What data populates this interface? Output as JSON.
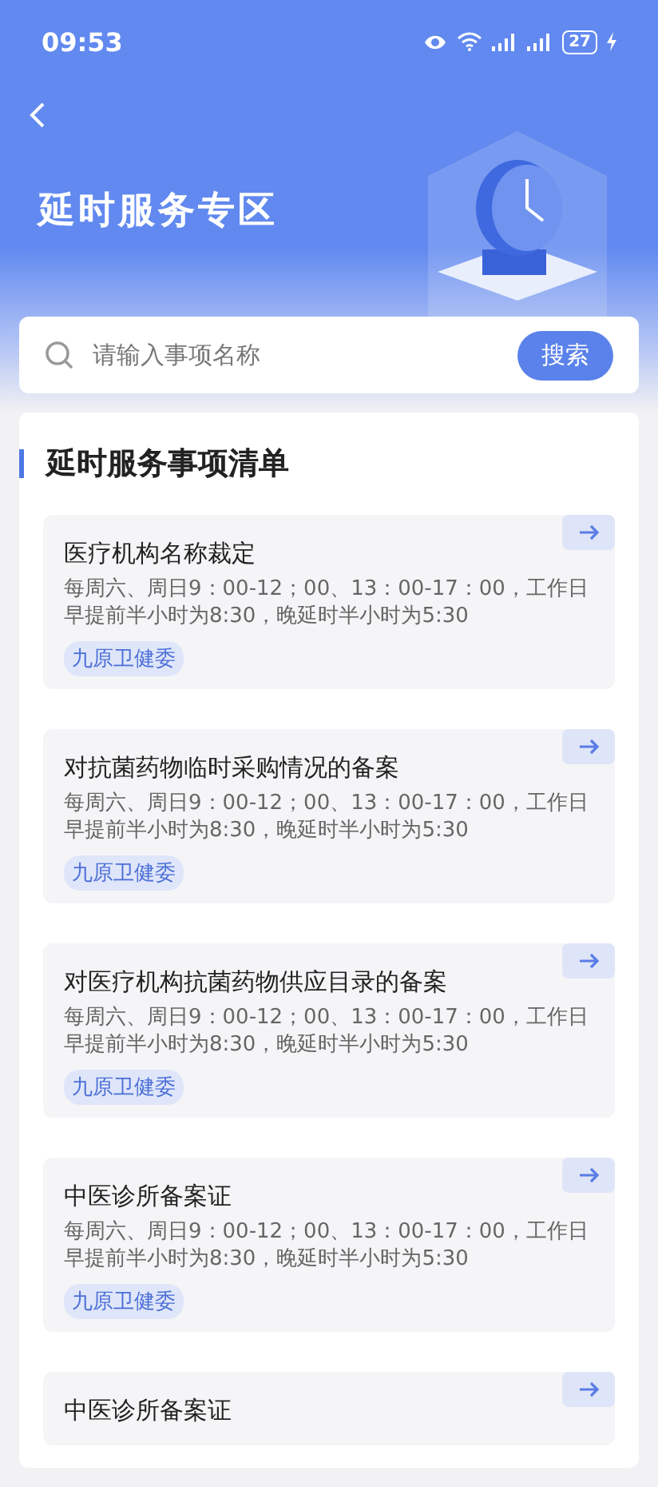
{
  "status_bar": {
    "time": "09:53",
    "battery": "27"
  },
  "header": {
    "title": "延时服务专区"
  },
  "search": {
    "placeholder": "请输入事项名称",
    "button": "搜索"
  },
  "list": {
    "heading": "延时服务事项清单",
    "items": [
      {
        "title": "医疗机构名称裁定",
        "hours": "每周六、周日9：00-12；00、13：00-17：00，工作日早提前半小时为8:30，晚延时半小时为5:30",
        "tag": "九原卫健委"
      },
      {
        "title": "对抗菌药物临时采购情况的备案",
        "hours": "每周六、周日9：00-12；00、13：00-17：00，工作日早提前半小时为8:30，晚延时半小时为5:30",
        "tag": "九原卫健委"
      },
      {
        "title": "对医疗机构抗菌药物供应目录的备案",
        "hours": "每周六、周日9：00-12；00、13：00-17：00，工作日早提前半小时为8:30，晚延时半小时为5:30",
        "tag": "九原卫健委"
      },
      {
        "title": "中医诊所备案证",
        "hours": "每周六、周日9：00-12；00、13：00-17：00，工作日早提前半小时为8:30，晚延时半小时为5:30",
        "tag": "九原卫健委"
      },
      {
        "title": "中医诊所备案证"
      }
    ]
  }
}
